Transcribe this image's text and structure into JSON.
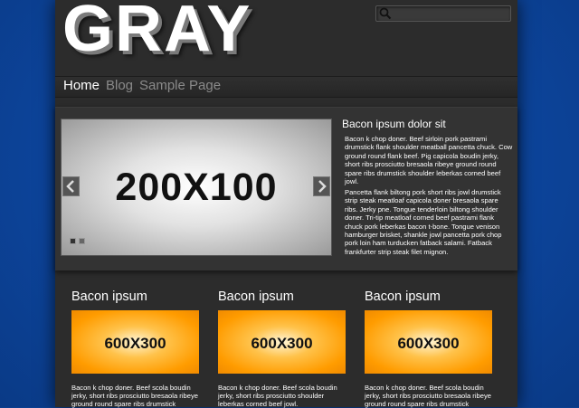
{
  "header": {
    "logo": "GRAY",
    "search": {
      "placeholder": "",
      "value": ""
    }
  },
  "nav": {
    "items": [
      {
        "label": "Home",
        "active": true
      },
      {
        "label": "Blog",
        "active": false
      },
      {
        "label": "Sample Page",
        "active": false
      }
    ]
  },
  "featured": {
    "slider": {
      "image_text": "200X100",
      "prev_icon": "arrow-left-icon",
      "next_icon": "arrow-right-icon",
      "slide_count": 2,
      "active_slide": 1
    },
    "post": {
      "title": "Bacon ipsum dolor sit",
      "paragraphs": [
        "Bacon k chop doner. Beef sirloin pork pastrami drumstick flank shoulder meatball pancetta chuck. Cow ground round flank beef. Pig capicola boudin jerky, short ribs prosciutto bresaola ribeye ground round spare ribs drumstick shoulder leberkas corned beef jowl.",
        "Pancetta flank biltong pork short ribs jowl drumstick strip steak meatloaf capicola doner bresaola spare ribs. Jerky pne. Tongue tenderloin biltong shoulder doner. Tri-tip meatloaf corned beef pastrami flank chuck pork leberkas bacon t-bone. Tongue venison hamburger brisket, shankle jowl pancetta pork chop pork loin ham turducken fatback salami. Fatback frankfurter strip steak filet mignon."
      ]
    }
  },
  "columns": [
    {
      "title": "Bacon ipsum",
      "image_text": "600X300",
      "text": "Bacon k chop doner. Beef scola boudin jerky, short ribs prosciutto bresaola ribeye ground round spare ribs drumstick"
    },
    {
      "title": "Bacon ipsum",
      "image_text": "600X300",
      "text": "Bacon k chop doner. Beef scola boudin jerky, short ribs prosciutto shoulder leberkas corned beef jowl."
    },
    {
      "title": "Bacon ipsum",
      "image_text": "600X300",
      "text": "Bacon k chop doner. Beef scola boudin jerky, short ribs prosciutto bresaola ribeye ground round spare ribs drumstick"
    }
  ],
  "colors": {
    "page_background": "#0d47a1",
    "site_background": "#2c2c2c",
    "accent_orange": "#ff9c00"
  }
}
